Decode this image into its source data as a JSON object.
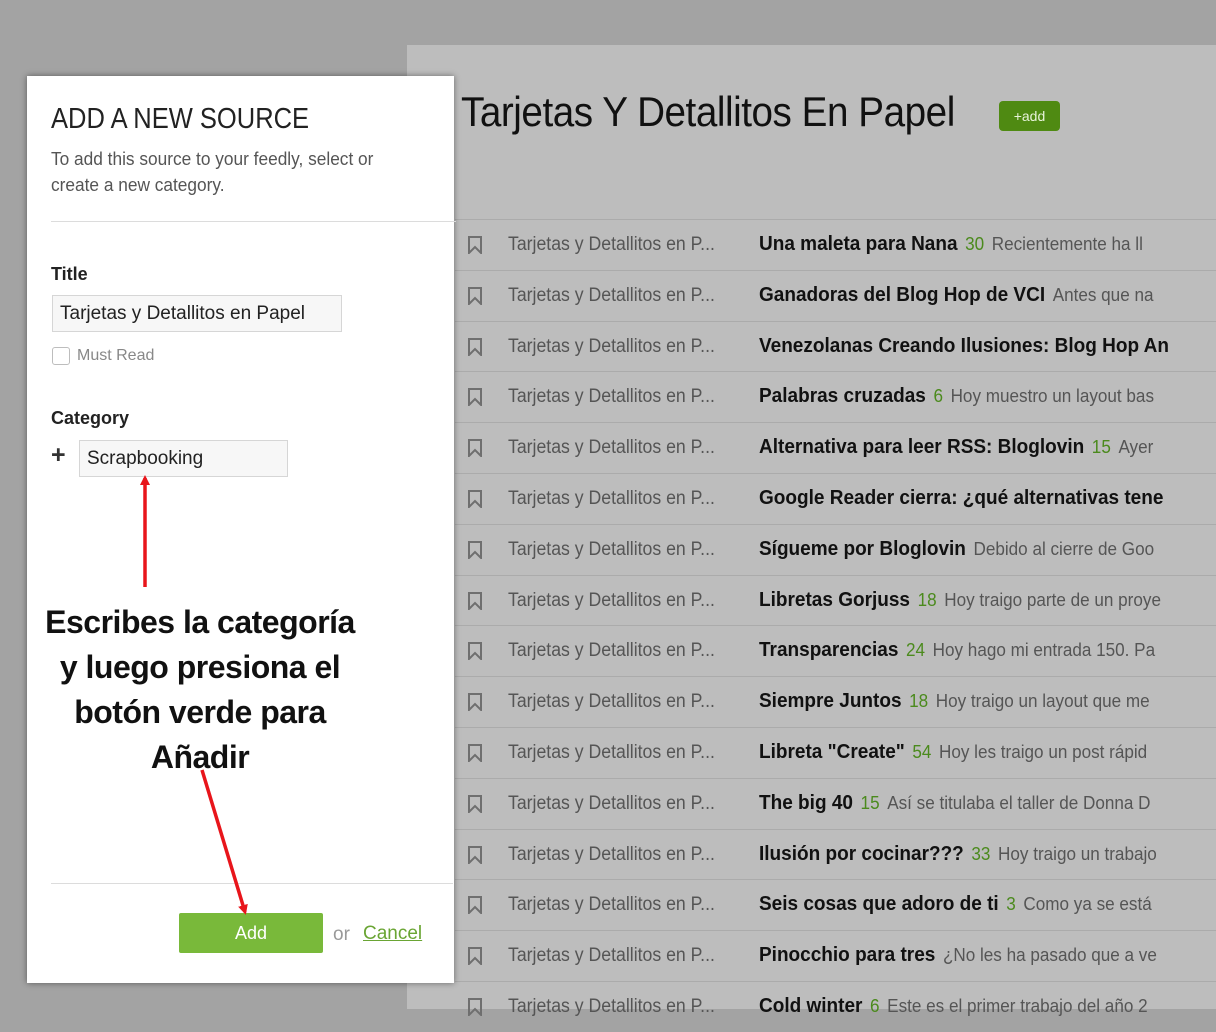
{
  "feed": {
    "title": "Tarjetas Y Detallitos En Papel",
    "add_label": "+add",
    "rows": [
      {
        "source": "Tarjetas y Detallitos en P...",
        "title": "Una maleta para Nana",
        "count": "30",
        "snippet": "Recientemente ha ll"
      },
      {
        "source": "Tarjetas y Detallitos en P...",
        "title": "Ganadoras del Blog Hop de VCI",
        "count": "",
        "snippet": "Antes que na"
      },
      {
        "source": "Tarjetas y Detallitos en P...",
        "title": "Venezolanas Creando Ilusiones: Blog Hop An",
        "count": "",
        "snippet": ""
      },
      {
        "source": "Tarjetas y Detallitos en P...",
        "title": "Palabras cruzadas",
        "count": "6",
        "snippet": "Hoy muestro un layout bas"
      },
      {
        "source": "Tarjetas y Detallitos en P...",
        "title": "Alternativa para leer RSS: Bloglovin",
        "count": "15",
        "snippet": "Ayer"
      },
      {
        "source": "Tarjetas y Detallitos en P...",
        "title": "Google Reader cierra: ¿qué alternativas tene",
        "count": "",
        "snippet": ""
      },
      {
        "source": "Tarjetas y Detallitos en P...",
        "title": "Sígueme por Bloglovin",
        "count": "",
        "snippet": "Debido al cierre de Goo"
      },
      {
        "source": "Tarjetas y Detallitos en P...",
        "title": "Libretas Gorjuss",
        "count": "18",
        "snippet": "Hoy traigo parte de un proye"
      },
      {
        "source": "Tarjetas y Detallitos en P...",
        "title": "Transparencias",
        "count": "24",
        "snippet": "Hoy hago mi entrada 150. Pa"
      },
      {
        "source": "Tarjetas y Detallitos en P...",
        "title": "Siempre Juntos",
        "count": "18",
        "snippet": "Hoy traigo un layout que me"
      },
      {
        "source": "Tarjetas y Detallitos en P...",
        "title": "Libreta \"Create\"",
        "count": "54",
        "snippet": "Hoy les traigo un post rápid"
      },
      {
        "source": "Tarjetas y Detallitos en P...",
        "title": "The big 40",
        "count": "15",
        "snippet": "Así se titulaba el taller de Donna D"
      },
      {
        "source": "Tarjetas y Detallitos en P...",
        "title": "Ilusión por cocinar???",
        "count": "33",
        "snippet": "Hoy traigo un trabajo"
      },
      {
        "source": "Tarjetas y Detallitos en P...",
        "title": "Seis cosas que adoro de ti",
        "count": "3",
        "snippet": "Como ya se está"
      },
      {
        "source": "Tarjetas y Detallitos en P...",
        "title": "Pinocchio para tres",
        "count": "",
        "snippet": "¿No les ha pasado que a ve"
      },
      {
        "source": "Tarjetas y Detallitos en P...",
        "title": "Cold winter",
        "count": "6",
        "snippet": "Este es el primer trabajo del año 2"
      }
    ]
  },
  "dialog": {
    "title": "ADD A NEW SOURCE",
    "description": "To add this source to your feedly, select or create a new category.",
    "title_label": "Title",
    "title_value": "Tarjetas y Detallitos en Papel",
    "must_read_label": "Must Read",
    "category_label": "Category",
    "category_value": "Scrapbooking",
    "add_button": "Add",
    "or_text": "or",
    "cancel_link": "Cancel"
  },
  "annotation": {
    "lines": [
      "Escribes la categoría",
      "y luego presiona el",
      "botón verde para",
      "Añadir"
    ]
  },
  "colors": {
    "accent_green": "#79b93a",
    "annotation_arrow": "#e8151b"
  }
}
